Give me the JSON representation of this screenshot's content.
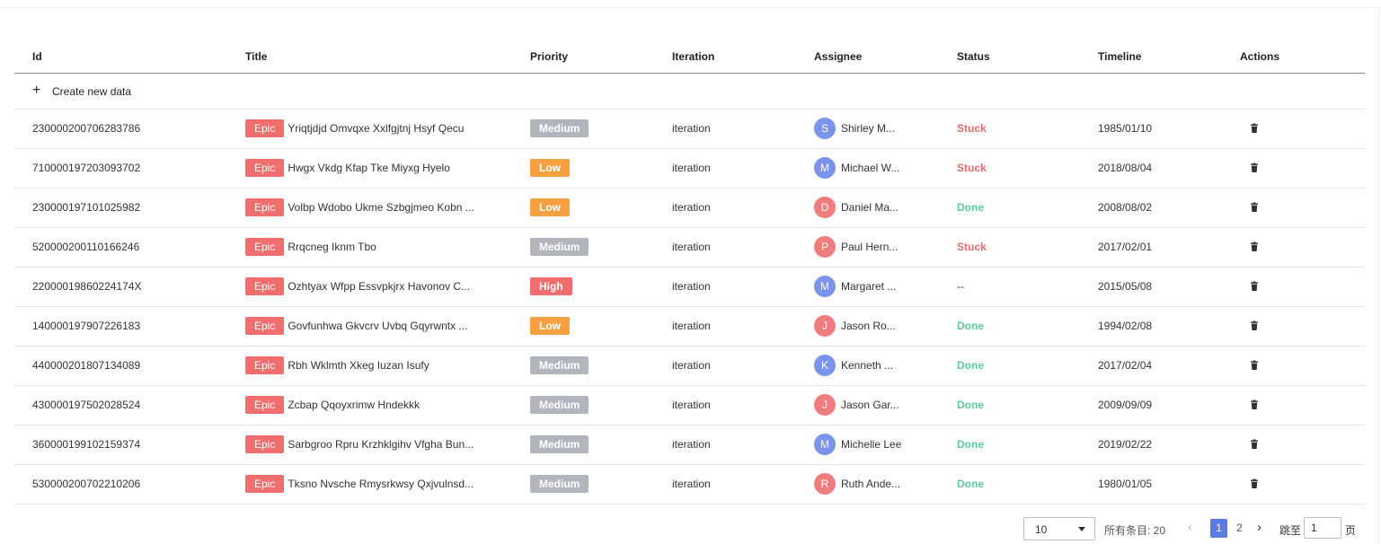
{
  "colors": {
    "epic": "#f06e6e",
    "priority_medium": "#b4b4bc",
    "priority_low": "#f7a041",
    "priority_high": "#f06e6e",
    "avatar_blue": "#7b93ea",
    "avatar_red": "#f07d7d",
    "status_stuck": "#e06c6c",
    "status_done": "#5cc99a",
    "accent": "#5b7be0"
  },
  "headers": {
    "id": "Id",
    "title": "Title",
    "priority": "Priority",
    "iteration": "Iteration",
    "assignee": "Assignee",
    "status": "Status",
    "timeline": "Timeline",
    "actions": "Actions"
  },
  "create": {
    "icon": "plus-icon",
    "label": "Create new data"
  },
  "rows": [
    {
      "id": "230000200706283786",
      "tag": "Epic",
      "title": "Yriqtjdjd Omvqxe Xxlfgjtnj Hsyf Qecu",
      "priority": "Medium",
      "iteration": "iteration",
      "avatar": "S",
      "assignee": "Shirley M...",
      "status": "Stuck",
      "timeline": "1985/01/10"
    },
    {
      "id": "710000197203093702",
      "tag": "Epic",
      "title": "Hwgx Vkdg Kfap Tke Miyxg Hyelo",
      "priority": "Low",
      "iteration": "iteration",
      "avatar": "M",
      "assignee": "Michael W...",
      "status": "Stuck",
      "timeline": "2018/08/04"
    },
    {
      "id": "230000197101025982",
      "tag": "Epic",
      "title": "Volbp Wdobo Ukme Szbgjmeo Kobn ...",
      "priority": "Low",
      "iteration": "iteration",
      "avatar": "D",
      "assignee": "Daniel Ma...",
      "status": "Done",
      "timeline": "2008/08/02"
    },
    {
      "id": "520000200110166246",
      "tag": "Epic",
      "title": "Rrqcneg Iknm Tbo",
      "priority": "Medium",
      "iteration": "iteration",
      "avatar": "P",
      "assignee": "Paul Hern...",
      "status": "Stuck",
      "timeline": "2017/02/01"
    },
    {
      "id": "22000019860224174X",
      "tag": "Epic",
      "title": "Ozhtyax Wfpp Essvpkjrx Havonov C...",
      "priority": "High",
      "iteration": "iteration",
      "avatar": "M",
      "assignee": "Margaret ...",
      "status": "--",
      "timeline": "2015/05/08"
    },
    {
      "id": "140000197907226183",
      "tag": "Epic",
      "title": "Govfunhwa Gkvcrv Uvbq Gqyrwntx ...",
      "priority": "Low",
      "iteration": "iteration",
      "avatar": "J",
      "assignee": "Jason Ro...",
      "status": "Done",
      "timeline": "1994/02/08"
    },
    {
      "id": "440000201807134089",
      "tag": "Epic",
      "title": "Rbh Wklmth Xkeg Iuzan Isufy",
      "priority": "Medium",
      "iteration": "iteration",
      "avatar": "K",
      "assignee": "Kenneth ...",
      "status": "Done",
      "timeline": "2017/02/04"
    },
    {
      "id": "430000197502028524",
      "tag": "Epic",
      "title": "Zcbap Qqoyxrimw Hndekkk",
      "priority": "Medium",
      "iteration": "iteration",
      "avatar": "J",
      "assignee": "Jason Gar...",
      "status": "Done",
      "timeline": "2009/09/09"
    },
    {
      "id": "360000199102159374",
      "tag": "Epic",
      "title": "Sarbgroo Rpru Krzhklgihv Vfgha Bun...",
      "priority": "Medium",
      "iteration": "iteration",
      "avatar": "M",
      "assignee": "Michelle Lee",
      "status": "Done",
      "timeline": "2019/02/22"
    },
    {
      "id": "530000200702210206",
      "tag": "Epic",
      "title": "Tksno Nvsche Rmysrkwsy Qxjvulnsd...",
      "priority": "Medium",
      "iteration": "iteration",
      "avatar": "R",
      "assignee": "Ruth Ande...",
      "status": "Done",
      "timeline": "1980/01/05"
    }
  ],
  "row_action_icon": "trash-icon",
  "pagination": {
    "page_size": "10",
    "total_label": "所有条目: 20",
    "prev_icon": "chevron-left-icon",
    "next_icon": "chevron-right-icon",
    "pages": [
      "1",
      "2"
    ],
    "current_page": "1",
    "jump_label": "跳至",
    "jump_value": "1",
    "page_suffix": "页"
  }
}
